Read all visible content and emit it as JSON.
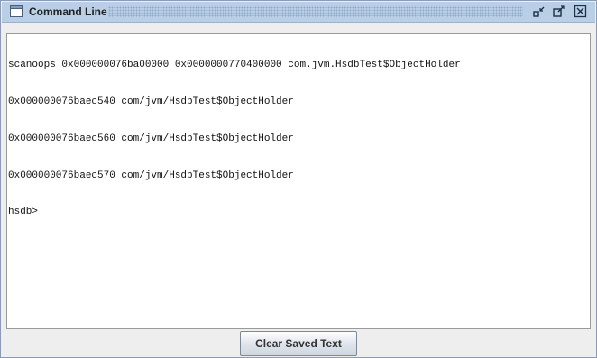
{
  "window": {
    "title": "Command Line",
    "icon": "window-icon",
    "buttons": [
      "restore-icon",
      "maximize-icon",
      "close-icon"
    ]
  },
  "console": {
    "lines": [
      "scanoops 0x000000076ba00000 0x0000000770400000 com.jvm.HsdbTest$ObjectHolder",
      "0x000000076baec540 com/jvm/HsdbTest$ObjectHolder",
      "0x000000076baec560 com/jvm/HsdbTest$ObjectHolder",
      "0x000000076baec570 com/jvm/HsdbTest$ObjectHolder",
      "hsdb>"
    ]
  },
  "footer": {
    "clear_label": "Clear Saved Text"
  }
}
